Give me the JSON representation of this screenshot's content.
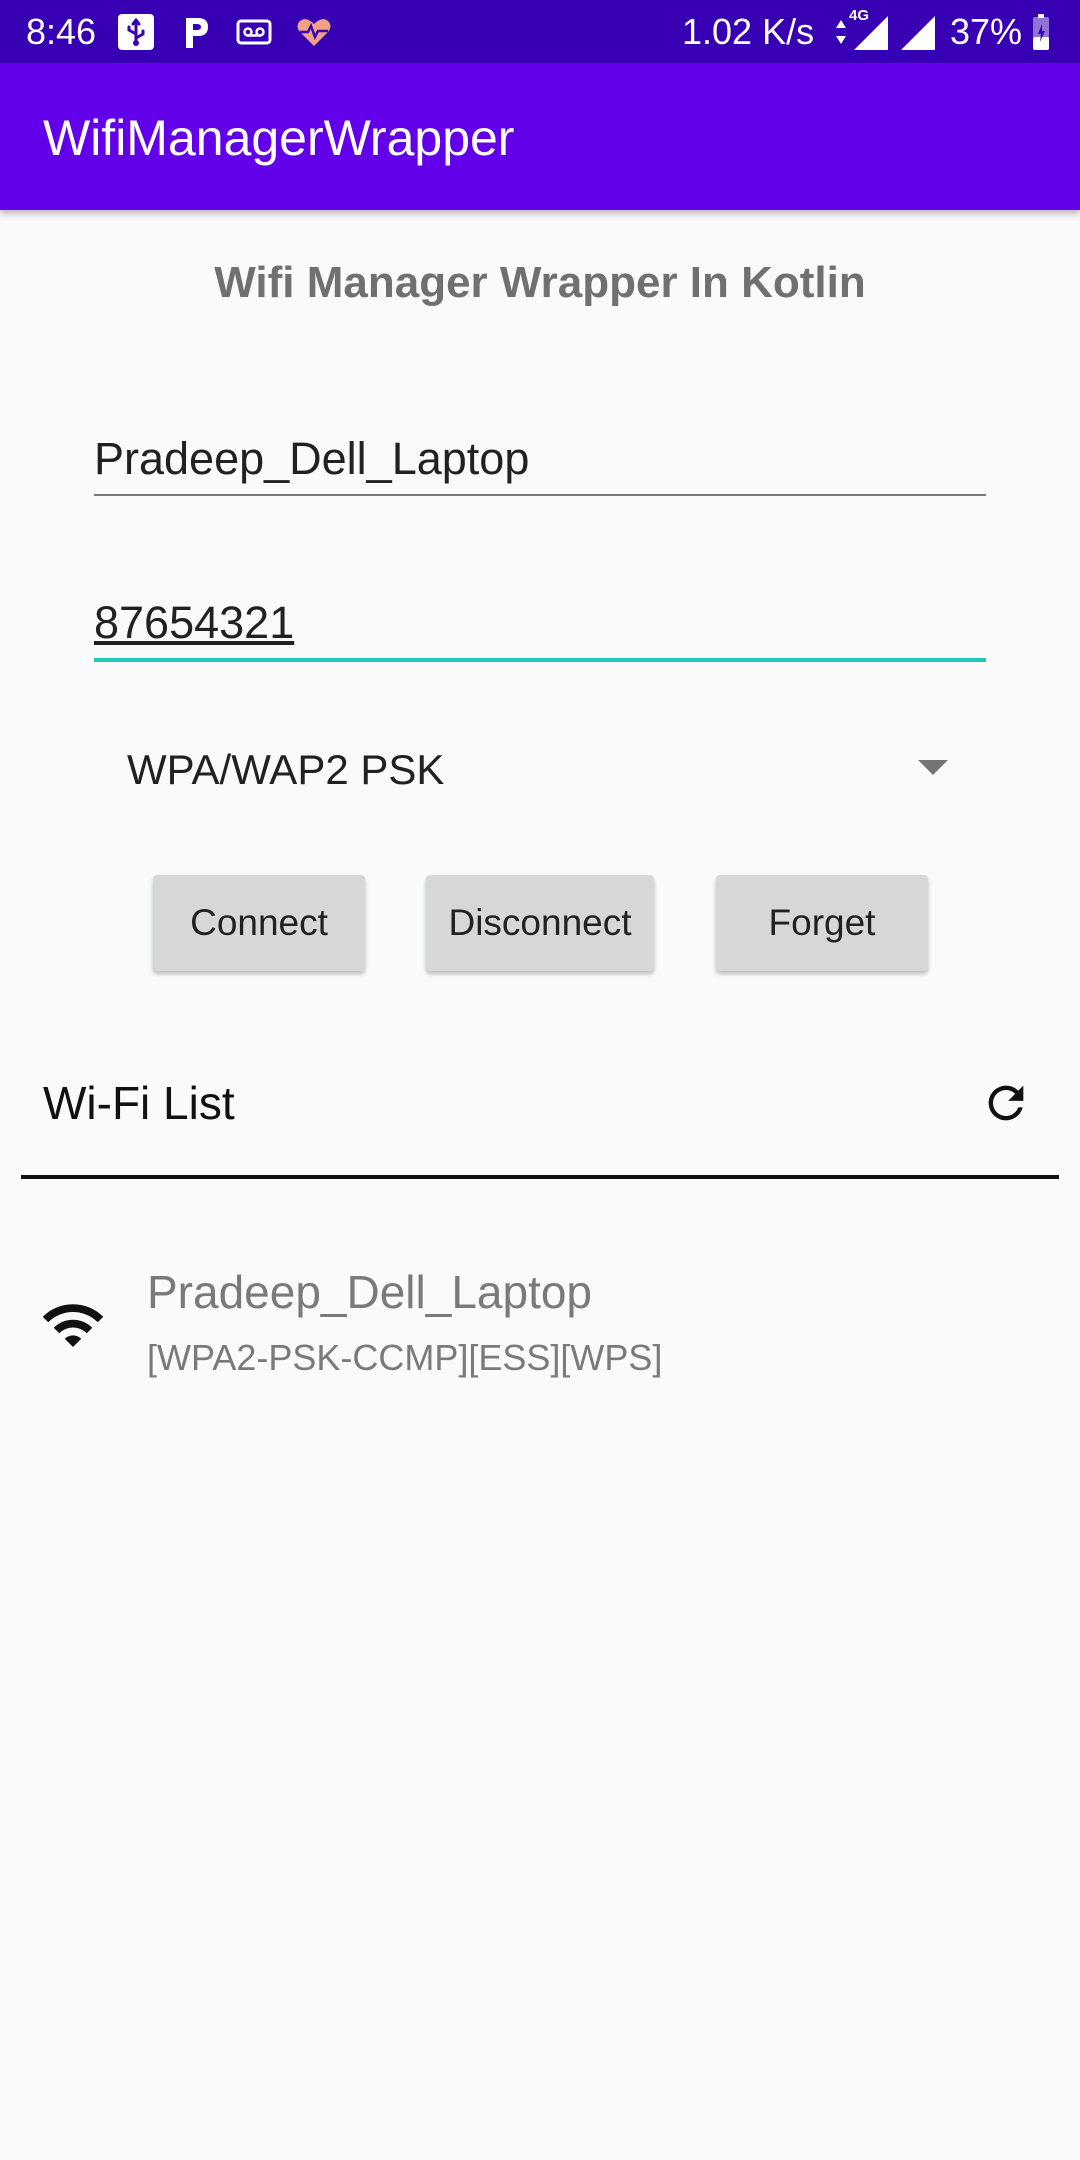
{
  "status_bar": {
    "time": "8:46",
    "network_speed": "1.02 K/s",
    "network_type": "4G",
    "battery": "37%",
    "icons": [
      "usb-icon",
      "p-app-icon",
      "voicemail-icon",
      "heart-rate-icon",
      "data-arrows-icon",
      "signal-icon",
      "battery-icon"
    ],
    "accent_color": "#3700b3"
  },
  "app_bar": {
    "title": "WifiManagerWrapper",
    "color": "#6200ea"
  },
  "form": {
    "heading": "Wifi Manager Wrapper In Kotlin",
    "ssid_value": "Pradeep_Dell_Laptop",
    "password_value": "87654321",
    "security_selected": "WPA/WAP2 PSK",
    "focus_color": "#1ec9b7",
    "buttons": {
      "connect": "Connect",
      "disconnect": "Disconnect",
      "forget": "Forget"
    }
  },
  "wifi_list": {
    "title": "Wi-Fi List",
    "refresh_icon": "refresh-icon",
    "items": [
      {
        "ssid": "Pradeep_Dell_Laptop",
        "capabilities": "[WPA2-PSK-CCMP][ESS][WPS]",
        "icon": "wifi-signal-icon"
      }
    ]
  }
}
